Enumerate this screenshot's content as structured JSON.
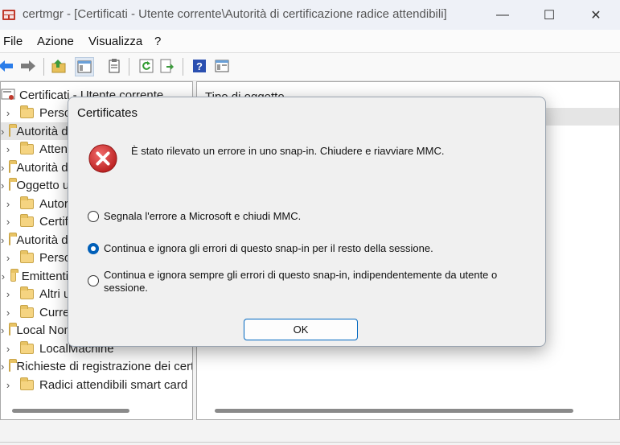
{
  "window": {
    "title": "certmgr - [Certificati - Utente corrente\\Autorità di certificazione radice attendibili]",
    "minimize_glyph": "—",
    "maximize_glyph": "☐",
    "close_glyph": "✕"
  },
  "menu": {
    "items": [
      "File",
      "Azione",
      "Visualizza",
      "?"
    ]
  },
  "toolbar": {
    "icons": [
      "back-icon",
      "forward-icon",
      "up-folder-icon",
      "show-hide-tree-icon",
      "clipboard-icon",
      "refresh-icon",
      "export-icon",
      "help-icon",
      "properties-icon"
    ]
  },
  "tree": {
    "root": "Certificati - Utente corrente",
    "items": [
      "Personale",
      "Autorità di certificazione radice attendibili",
      "Attendibilità organizzazione",
      "Autorità di certificazione intermedie",
      "Oggetto utente di Active Directory",
      "Autori attendibili",
      "Certificati non attendibili",
      "Autorità di certificazione radice di terze parti",
      "Persone attendibili",
      "Emittenti di autenticazione client",
      "Altri utenti",
      "CurrentUser",
      "Local NonRemovable Certificates",
      "LocalMachine",
      "Richieste di registrazione dei certificati",
      "Radici attendibili smart card"
    ],
    "selected_index": 1
  },
  "list": {
    "column_header": "Tipo di oggetto"
  },
  "dialog": {
    "title": "Certificates",
    "message": "È stato rilevato un errore in uno snap-in. Chiudere e riavviare MMC.",
    "options": [
      {
        "label": "Segnala l'errore a Microsoft e chiudi MMC.",
        "selected": false
      },
      {
        "label": "Continua e ignora gli errori di questo snap-in per il resto della sessione.",
        "selected": true
      },
      {
        "label": "Continua e ignora sempre gli errori di questo snap-in, indipendentemente da utente o sessione.",
        "selected": false
      }
    ],
    "ok_label": "OK"
  },
  "colors": {
    "accent": "#005fb8",
    "error": "#d32f2f",
    "folder": "#f5d481"
  }
}
